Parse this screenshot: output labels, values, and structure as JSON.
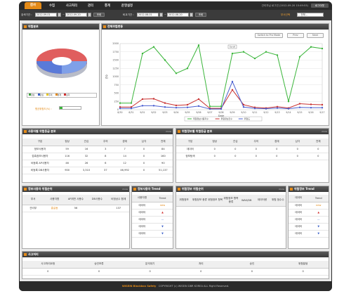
{
  "nav": {
    "tabs": [
      "감사",
      "수집",
      "사고처리",
      "관리",
      "통계",
      "운영설정"
    ],
    "active_index": 0,
    "user_info": "관리자님 로그인 (2012-09-20 15:49:53)",
    "logout_label": "로그아웃"
  },
  "filters": {
    "period_label": "검색기간 :",
    "period_start": "2012-09-01",
    "period_end": "2012-09-20",
    "period_button": "조회",
    "compare_label": "비교기간 :",
    "compare_start": "2012-08-01",
    "compare_end": "2012-08-20",
    "compare_button": "조회",
    "dept_label": "부서선택",
    "dept_value": "-- 전체 --"
  },
  "risk_panel": {
    "title": "위험분포",
    "legend": [
      "정상",
      "관심",
      "주의",
      "경계",
      "심각"
    ],
    "legend_colors": [
      "#3aa03a",
      "#3a5fc8",
      "#e6c51a",
      "#e48a17",
      "#d23030"
    ],
    "avg_label": "평균위험도(%) :",
    "avg_value": ""
  },
  "trend_panel": {
    "title": "전체위험변동",
    "switch_label": "Switch to Pro Mode",
    "prev_label": "Prev",
    "next_label": "Next",
    "popup_label": "Scroll"
  },
  "chart_data": {
    "type": "line",
    "ylabel": "건수",
    "xlabel": "Date",
    "ylim": [
      0,
      2000
    ],
    "yticks": [
      "0",
      "250",
      "500",
      "750",
      "1000",
      "1250",
      "1500",
      "1750",
      "2000"
    ],
    "categories": [
      "8/30",
      "8/31",
      "9/01",
      "9/02",
      "9/03",
      "9/04",
      "9/05",
      "9/06",
      "9/07",
      "9/08",
      "9/09",
      "9/10",
      "9/11",
      "9/12",
      "9/13",
      "9/14",
      "9/15",
      "9/16",
      "9/17"
    ],
    "series": [
      {
        "name": "위험정보사용자수",
        "color": "#3ab53a",
        "values": [
          200,
          200,
          1700,
          1900,
          1500,
          1100,
          1250,
          1950,
          100,
          100,
          1700,
          1750,
          1550,
          1750,
          1650,
          250,
          1600,
          1900,
          1850
        ]
      },
      {
        "name": "위험정보건수",
        "color": "#c83030",
        "values": [
          80,
          80,
          320,
          330,
          200,
          130,
          150,
          320,
          40,
          40,
          600,
          150,
          70,
          50,
          90,
          50,
          180,
          160,
          150
        ]
      },
      {
        "name": "위험도",
        "color": "#4a5fd0",
        "values": [
          40,
          40,
          120,
          120,
          80,
          60,
          70,
          110,
          20,
          20,
          850,
          80,
          40,
          30,
          50,
          30,
          70,
          60,
          60
        ]
      }
    ]
  },
  "user_risk": {
    "title": "사용자별 위험등급 분포",
    "more": "more",
    "headers": [
      "구분",
      "정상",
      "관심",
      "주의",
      "경계",
      "심각",
      "전체"
    ],
    "rows": [
      [
        "정보사용자",
        "59",
        "16",
        "3",
        "7",
        "0",
        "84"
      ],
      [
        "접촉정보사용자",
        "116",
        "32",
        "8",
        "14",
        "0",
        "160"
      ],
      [
        "비등록 AP사용자",
        "46",
        "26",
        "6",
        "12",
        "0",
        "90"
      ],
      [
        "비등록 DB사용자",
        "900",
        "3,310",
        "37",
        "46,992",
        "0",
        "51,137"
      ]
    ]
  },
  "info_risk": {
    "title": "위험정보별 위험등급 분포",
    "more": "more",
    "headers": [
      "구분",
      "정상",
      "관심",
      "주의",
      "경계",
      "심각",
      "전체"
    ],
    "rows": [
      [
        "데이터",
        "0",
        "0",
        "0",
        "0",
        "0",
        "0"
      ],
      [
        "정보탐색",
        "0",
        "0",
        "0",
        "0",
        "0",
        "0"
      ]
    ]
  },
  "user_rank": {
    "title": "정보사용자 위험순위",
    "more": "more",
    "headers": [
      "부서",
      "사용자명",
      "AP위반 사용수",
      "DB사용수",
      "비정상수 합계"
    ],
    "rows": [
      [
        "관리부",
        "홍길동",
        "56",
        "",
        "137"
      ]
    ]
  },
  "user_trend": {
    "title": "정보사용자 Trend",
    "headers": [
      "사용자명",
      "Trend"
    ],
    "rows": [
      [
        "데이터",
        "new"
      ],
      [
        "데이터",
        "▲"
      ],
      [
        "데이터",
        "—"
      ],
      [
        "데이터",
        "▼"
      ],
      [
        "데이터",
        "▼"
      ]
    ]
  },
  "info_rank": {
    "title": "위험정보 위험순위",
    "more": "more",
    "headers": [
      "위험정보",
      "위험정보 종류",
      "위험정보 항목",
      "위험정보 항목종류",
      "WAS/DB",
      "데이터량",
      "위험 점수수"
    ]
  },
  "info_trend": {
    "title": "위험정보 Trend",
    "headers": [
      "데이터",
      "Trend"
    ],
    "rows": [
      [
        "데이터",
        "new"
      ],
      [
        "데이터",
        "▲"
      ],
      [
        "데이터",
        "—"
      ],
      [
        "데이터",
        "▼"
      ],
      [
        "데이터",
        "▼"
      ]
    ]
  },
  "incident": {
    "title": "사고처리",
    "headers": [
      "사고처리요청",
      "승인보류",
      "분석대기",
      "처리",
      "승인",
      "위험발생"
    ],
    "values": [
      "0",
      "0",
      "0",
      "0",
      "0",
      "0"
    ]
  },
  "footer": {
    "brand": "WISEIN Blackbox Safety",
    "copyright": "COPYRIGHT (c) WISEIN DBR KOREA ALL Right Reserved."
  }
}
